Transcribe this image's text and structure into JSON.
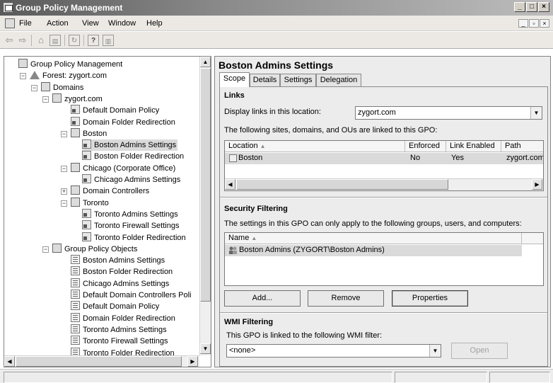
{
  "window": {
    "title": "Group Policy Management",
    "controls": [
      "_",
      "□",
      "×"
    ]
  },
  "menu": {
    "items": [
      "File",
      "Action",
      "View",
      "Window",
      "Help"
    ]
  },
  "tree": {
    "items": [
      {
        "label": "Group Policy Management",
        "icon": "gpm-icon",
        "expander": ""
      },
      {
        "label": "Forest: zygort.com",
        "icon": "forest-icon",
        "expander": "−"
      },
      {
        "label": "Domains",
        "icon": "domains-icon",
        "expander": "−"
      },
      {
        "label": "zygort.com",
        "icon": "domain-icon",
        "expander": "−"
      },
      {
        "label": "Default Domain Policy",
        "icon": "gpo-link-icon",
        "expander": ""
      },
      {
        "label": "Domain Folder Redirection",
        "icon": "gpo-link-icon",
        "expander": ""
      },
      {
        "label": "Boston",
        "icon": "ou-icon",
        "expander": "−"
      },
      {
        "label": "Boston Admins Settings",
        "icon": "gpo-link-icon",
        "expander": "",
        "selected": true
      },
      {
        "label": "Boston Folder Redirection",
        "icon": "gpo-link-icon",
        "expander": ""
      },
      {
        "label": "Chicago (Corporate Office)",
        "icon": "ou-blocked-icon",
        "expander": "−"
      },
      {
        "label": "Chicago Admins Settings",
        "icon": "gpo-link-icon",
        "expander": ""
      },
      {
        "label": "Domain Controllers",
        "icon": "ou-icon",
        "expander": "+"
      },
      {
        "label": "Toronto",
        "icon": "ou-icon",
        "expander": "−"
      },
      {
        "label": "Toronto Admins Settings",
        "icon": "gpo-link-icon",
        "expander": ""
      },
      {
        "label": "Toronto Firewall Settings",
        "icon": "gpo-link-icon",
        "expander": ""
      },
      {
        "label": "Toronto Folder Redirection",
        "icon": "gpo-link-icon",
        "expander": ""
      },
      {
        "label": "Group Policy Objects",
        "icon": "gpo-folder-icon",
        "expander": "−"
      },
      {
        "label": "Boston Admins Settings",
        "icon": "gpo-icon",
        "expander": ""
      },
      {
        "label": "Boston Folder Redirection",
        "icon": "gpo-icon",
        "expander": ""
      },
      {
        "label": "Chicago Admins Settings",
        "icon": "gpo-icon",
        "expander": ""
      },
      {
        "label": "Default Domain Controllers Poli",
        "icon": "gpo-icon",
        "expander": ""
      },
      {
        "label": "Default Domain Policy",
        "icon": "gpo-icon",
        "expander": ""
      },
      {
        "label": "Domain Folder Redirection",
        "icon": "gpo-icon",
        "expander": ""
      },
      {
        "label": "Toronto Admins Settings",
        "icon": "gpo-icon",
        "expander": ""
      },
      {
        "label": "Toronto Firewall Settings",
        "icon": "gpo-icon",
        "expander": ""
      },
      {
        "label": "Toronto Folder Redirection",
        "icon": "gpo-icon",
        "expander": ""
      }
    ]
  },
  "details": {
    "title": "Boston Admins Settings",
    "tabs": [
      "Scope",
      "Details",
      "Settings",
      "Delegation"
    ],
    "links": {
      "heading": "Links",
      "display_label": "Display links in this location:",
      "location_value": "zygort.com",
      "description": "The following sites, domains, and OUs are linked to this GPO:",
      "columns": [
        "Location",
        "Enforced",
        "Link Enabled",
        "Path"
      ],
      "rows": [
        {
          "location": "Boston",
          "enforced": "No",
          "link_enabled": "Yes",
          "path": "zygort.com/"
        }
      ]
    },
    "security": {
      "heading": "Security Filtering",
      "description": "The settings in this GPO can only apply to the following groups, users, and computers:",
      "columns": [
        "Name"
      ],
      "rows": [
        "Boston Admins (ZYGORT\\Boston Admins)"
      ],
      "buttons": {
        "add": "Add...",
        "remove": "Remove",
        "properties": "Properties"
      }
    },
    "wmi": {
      "heading": "WMI Filtering",
      "description": "This GPO is linked to the following WMI filter:",
      "value": "<none>",
      "open": "Open"
    }
  }
}
